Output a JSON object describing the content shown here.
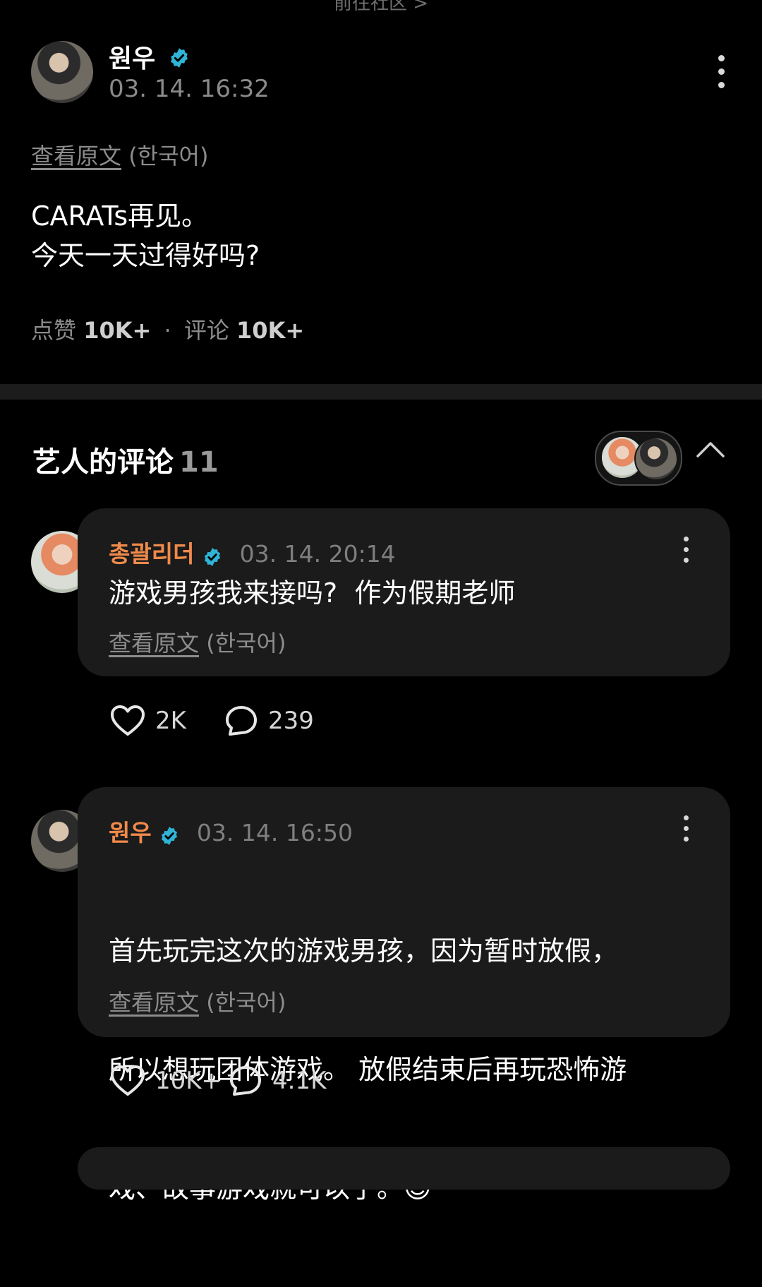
{
  "top_link": "前往社区 >",
  "post": {
    "author": "원우",
    "time": "03. 14. 16:32",
    "view_original": "查看原文",
    "lang": "(한국어)",
    "body_line1": "CARATs再见。",
    "body_line2": "今天一天过得好吗?",
    "likes_label": "点赞",
    "likes": "10K+",
    "separator": "·",
    "comments_label": "评论",
    "comments": "10K+"
  },
  "artist_comments": {
    "title": "艺人的评论",
    "count": "11"
  },
  "comments": [
    {
      "author": "총괄리더",
      "time": "03. 14. 20:14",
      "text": "游戏男孩我来接吗?  作为假期老师",
      "view_original": "查看原文",
      "lang": "(한국어)",
      "likes": "2K",
      "replies": "239"
    },
    {
      "author": "원우",
      "time": "03. 14. 16:50",
      "text_line1": "首先玩完这次的游戏男孩，因为暂时放假，",
      "text_line2": "所以想玩团体游戏。 放假结束后再玩恐怖游",
      "text_line3": "戏、故事游戏就可以了。😊",
      "view_original": "查看原文",
      "lang": "(한국어)",
      "likes": "10K+",
      "replies": "4.1K"
    }
  ],
  "colors": {
    "background": "#000000",
    "card": "#1b1b1b",
    "comment_author": "#f08a4b",
    "verified_badge": "#2fb4d6",
    "secondary_text": "#8c8c8c"
  },
  "icons": [
    "verified-icon",
    "more-vertical-icon",
    "chevron-up-icon",
    "heart-icon",
    "comment-icon"
  ]
}
